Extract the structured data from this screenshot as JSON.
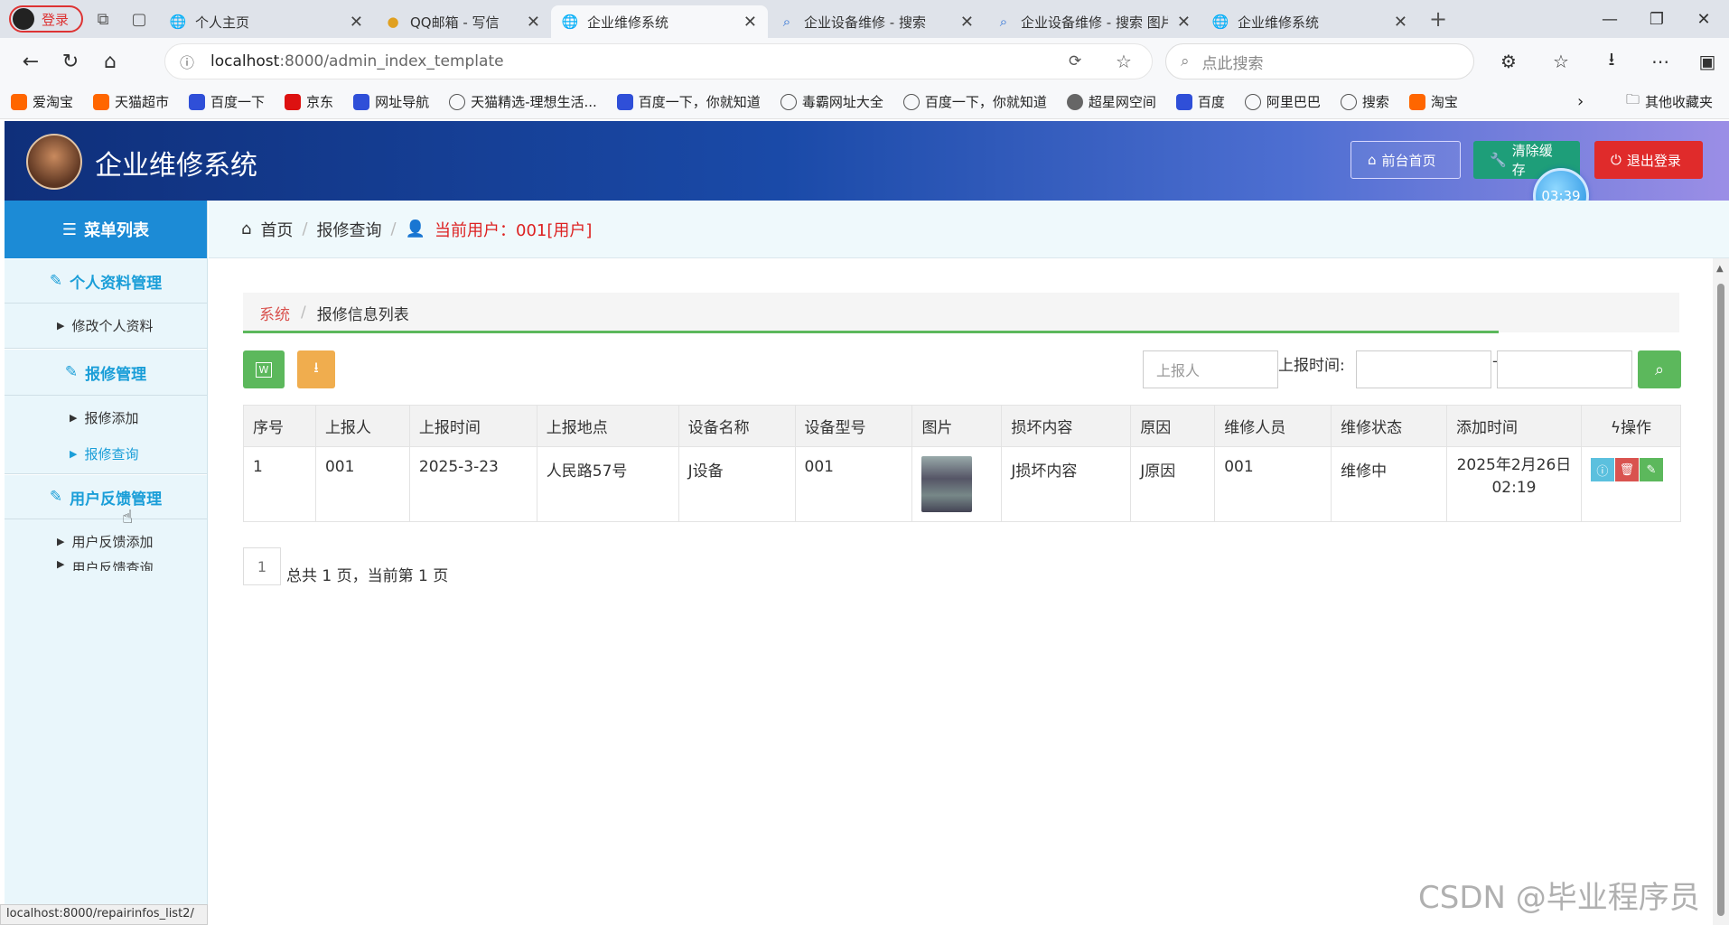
{
  "browser": {
    "login_label": "登录",
    "tabs": [
      {
        "title": "个人主页",
        "icon": "globe-icon"
      },
      {
        "title": "QQ邮箱 - 写信",
        "icon": "qq-mail-icon"
      },
      {
        "title": "企业维修系统",
        "icon": "globe-icon",
        "active": true
      },
      {
        "title": "企业设备维修 - 搜索",
        "icon": "search-icon"
      },
      {
        "title": "企业设备维修 - 搜索 图片",
        "icon": "search-icon"
      },
      {
        "title": "企业维修系统",
        "icon": "globe-icon"
      }
    ],
    "url_host": "localhost",
    "url_path": ":8000/admin_index_template",
    "search_placeholder": "点此搜索",
    "bookmarks": [
      "爱淘宝",
      "天猫超市",
      "百度一下",
      "京东",
      "网址导航",
      "天猫精选-理想生活...",
      "百度一下，你就知道",
      "毒霸网址大全",
      "百度一下，你就知道",
      "超星网空间",
      "百度",
      "阿里巴巴",
      "搜索",
      "淘宝"
    ],
    "other_favorites": "其他收藏夹",
    "status_url": "localhost:8000/repairinfos_list2/"
  },
  "app": {
    "title": "企业维修系统",
    "buttons": {
      "front": "前台首页",
      "clear": "清除缓存",
      "logout": "退出登录"
    },
    "timer": "03:39",
    "colors": {
      "header_start": "#0f2f7a",
      "primary": "#1c8bd6",
      "success": "#5cb85c",
      "warning": "#f0ad4e",
      "danger": "#e02b2b"
    }
  },
  "sidebar": {
    "heading": "菜单列表",
    "groups": [
      {
        "label": "个人资料管理",
        "items": [
          "修改个人资料"
        ]
      },
      {
        "label": "报修管理",
        "items": [
          "报修添加",
          "报修查询"
        ]
      },
      {
        "label": "用户反馈管理",
        "items": [
          "用户反馈添加",
          "用户反馈查询"
        ]
      }
    ]
  },
  "breadcrumb": {
    "home": "首页",
    "page": "报修查询",
    "user": "当前用户：001[用户]"
  },
  "panel": {
    "crumb_root": "系统",
    "crumb_current": "报修信息列表",
    "filter_reporter_placeholder": "上报人",
    "filter_time_label": "上报时间:",
    "filter_dash": "-"
  },
  "table": {
    "headers": [
      "序号",
      "上报人",
      "上报时间",
      "上报地点",
      "设备名称",
      "设备型号",
      "图片",
      "损坏内容",
      "原因",
      "维修人员",
      "维修状态",
      "添加时间",
      "操作"
    ],
    "rows": [
      {
        "no": "1",
        "reporter": "001",
        "time": "2025-3-23",
        "place": "人民路57号",
        "device": "J设备",
        "model": "001",
        "damage": "J损坏内容",
        "reason": "J原因",
        "repairer": "001",
        "status": "维修中",
        "added": "2025年2月26日 02:19"
      }
    ]
  },
  "pager": {
    "page": "1",
    "summary": "总共 1 页，当前第 1 页"
  },
  "watermark": "CSDN @毕业程序员"
}
